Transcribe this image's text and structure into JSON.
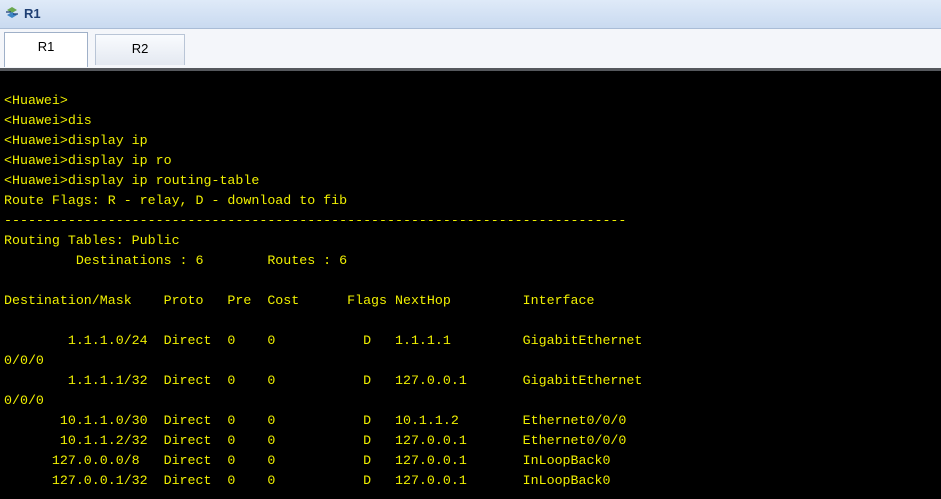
{
  "window": {
    "title": "R1",
    "app_icon": "ensp-router-icon"
  },
  "tabs": [
    {
      "label": "R1",
      "active": true
    },
    {
      "label": "R2",
      "active": false
    }
  ],
  "terminal": {
    "text_color": "#f0f000",
    "background": "#000000",
    "lines": [
      "",
      "<Huawei>",
      "<Huawei>dis",
      "<Huawei>display ip",
      "<Huawei>display ip ro",
      "<Huawei>display ip routing-table",
      "Route Flags: R - relay, D - download to fib",
      "------------------------------------------------------------------------------",
      "Routing Tables: Public",
      "         Destinations : 6        Routes : 6",
      "",
      "Destination/Mask    Proto   Pre  Cost      Flags NextHop         Interface",
      "",
      "        1.1.1.0/24  Direct  0    0           D   1.1.1.1         GigabitEthernet",
      "0/0/0",
      "        1.1.1.1/32  Direct  0    0           D   127.0.0.1       GigabitEthernet",
      "0/0/0",
      "       10.1.1.0/30  Direct  0    0           D   10.1.1.2        Ethernet0/0/0",
      "       10.1.1.2/32  Direct  0    0           D   127.0.0.1       Ethernet0/0/0",
      "      127.0.0.0/8   Direct  0    0           D   127.0.0.1       InLoopBack0",
      "      127.0.0.1/32  Direct  0    0           D   127.0.0.1       InLoopBack0"
    ]
  }
}
